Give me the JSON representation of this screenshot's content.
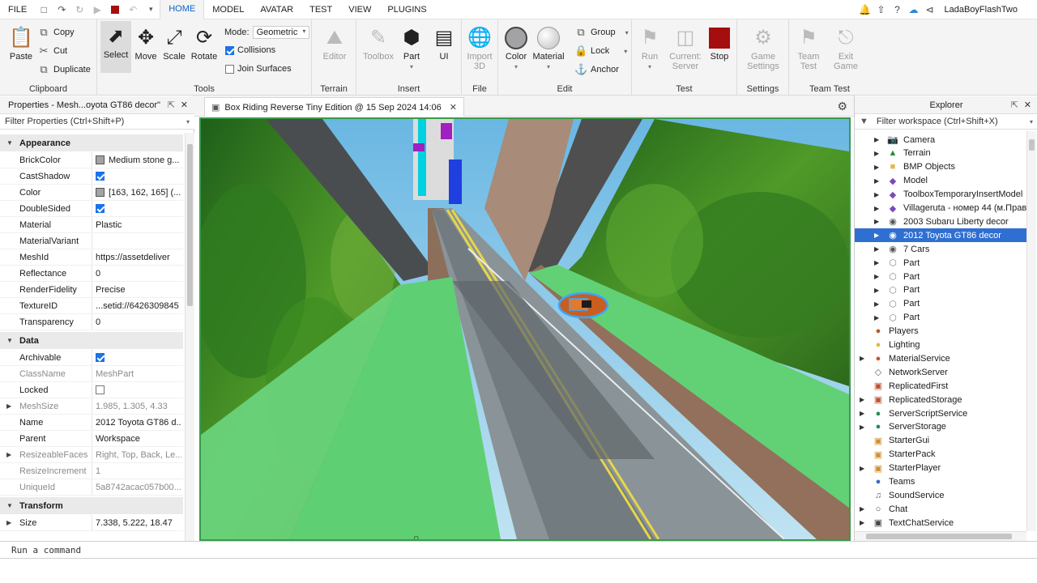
{
  "menubar": {
    "file_label": "FILE",
    "tabs": [
      "HOME",
      "MODEL",
      "AVATAR",
      "TEST",
      "VIEW",
      "PLUGINS"
    ],
    "active_tab": "HOME",
    "username": "LadaBoyFlashTwo"
  },
  "ribbon": {
    "clipboard": {
      "paste": "Paste",
      "copy": "Copy",
      "cut": "Cut",
      "duplicate": "Duplicate",
      "label": "Clipboard"
    },
    "tools": {
      "select": "Select",
      "move": "Move",
      "scale": "Scale",
      "rotate": "Rotate",
      "mode_label": "Mode:",
      "mode_value": "Geometric",
      "collisions": "Collisions",
      "join_surfaces": "Join Surfaces",
      "label": "Tools"
    },
    "terrain": {
      "editor": "Editor",
      "label": "Terrain"
    },
    "insert": {
      "toolbox": "Toolbox",
      "part": "Part",
      "ui": "UI",
      "label": "Insert"
    },
    "file": {
      "import_line1": "Import",
      "import_line2": "3D",
      "label": "File"
    },
    "edit": {
      "color": "Color",
      "material": "Material",
      "group": "Group",
      "lock": "Lock",
      "anchor": "Anchor",
      "label": "Edit"
    },
    "test": {
      "run": "Run",
      "current_line1": "Current:",
      "current_line2": "Server",
      "stop": "Stop",
      "label": "Test"
    },
    "settings": {
      "game_line1": "Game",
      "game_line2": "Settings",
      "label": "Settings"
    },
    "team_test": {
      "team_line1": "Team",
      "team_line2": "Test",
      "exit_line1": "Exit",
      "exit_line2": "Game",
      "label": "Team Test"
    }
  },
  "properties": {
    "title": "Properties - Mesh...oyota GT86 decor\"",
    "filter_placeholder": "Filter Properties (Ctrl+Shift+P)",
    "sections": [
      {
        "name": "Appearance",
        "rows": [
          {
            "name": "BrickColor",
            "value": "Medium stone g...",
            "swatch": "#a3a2a5"
          },
          {
            "name": "CastShadow",
            "check": true
          },
          {
            "name": "Color",
            "value": "[163, 162, 165] (...",
            "swatch": "#a3a2a5"
          },
          {
            "name": "DoubleSided",
            "check": true
          },
          {
            "name": "Material",
            "value": "Plastic"
          },
          {
            "name": "MaterialVariant",
            "value": ""
          },
          {
            "name": "MeshId",
            "value": "https://assetdeliver"
          },
          {
            "name": "Reflectance",
            "value": "0"
          },
          {
            "name": "RenderFidelity",
            "value": "Precise"
          },
          {
            "name": "TextureID",
            "value": "...setid://6426309845"
          },
          {
            "name": "Transparency",
            "value": "0"
          }
        ]
      },
      {
        "name": "Data",
        "rows": [
          {
            "name": "Archivable",
            "check": true
          },
          {
            "name": "ClassName",
            "value": "MeshPart",
            "gray": true
          },
          {
            "name": "Locked",
            "check": false
          },
          {
            "name": "MeshSize",
            "value": "1.985, 1.305, 4.33",
            "gray": true,
            "expand": true
          },
          {
            "name": "Name",
            "value": "2012 Toyota GT86 d..."
          },
          {
            "name": "Parent",
            "value": "Workspace"
          },
          {
            "name": "ResizeableFaces",
            "value": "Right, Top, Back, Le...",
            "gray": true,
            "expand": true
          },
          {
            "name": "ResizeIncrement",
            "value": "1",
            "gray": true
          },
          {
            "name": "UniqueId",
            "value": "5a8742acac057b00...",
            "gray": true
          }
        ]
      },
      {
        "name": "Transform",
        "rows": [
          {
            "name": "Size",
            "value": "7.338, 5.222, 18.47",
            "expand": true
          }
        ]
      }
    ]
  },
  "document": {
    "tab_title": "Box Riding Reverse Tiny Edition @ 15 Sep 2024 14:06"
  },
  "explorer": {
    "title": "Explorer",
    "filter_placeholder": "Filter workspace (Ctrl+Shift+X)",
    "items": [
      {
        "label": "Camera",
        "icon": "camera-icon",
        "depth": 1,
        "tri": true
      },
      {
        "label": "Terrain",
        "icon": "terrain-icon",
        "depth": 1,
        "tri": true
      },
      {
        "label": "BMP Objects",
        "icon": "folder-icon",
        "depth": 1,
        "tri": true
      },
      {
        "label": "Model",
        "icon": "model-icon",
        "depth": 1,
        "tri": true
      },
      {
        "label": "ToolboxTemporaryInsertModel",
        "icon": "model-icon",
        "depth": 1,
        "tri": true
      },
      {
        "label": "Villageruta - номер 44 (м.Правд",
        "icon": "model-icon",
        "depth": 1,
        "tri": true
      },
      {
        "label": "2003 Subaru Liberty decor",
        "icon": "meshpart-icon",
        "depth": 1,
        "tri": true
      },
      {
        "label": "2012 Toyota GT86 decor",
        "icon": "meshpart-icon",
        "depth": 1,
        "tri": true,
        "selected": true
      },
      {
        "label": "7 Cars",
        "icon": "meshpart-icon",
        "depth": 1,
        "tri": true
      },
      {
        "label": "Part",
        "icon": "part-icon",
        "depth": 1,
        "tri": true
      },
      {
        "label": "Part",
        "icon": "part-icon",
        "depth": 1,
        "tri": true
      },
      {
        "label": "Part",
        "icon": "part-icon",
        "depth": 1,
        "tri": true
      },
      {
        "label": "Part",
        "icon": "part-icon",
        "depth": 1,
        "tri": true
      },
      {
        "label": "Part",
        "icon": "part-icon",
        "depth": 1,
        "tri": true
      },
      {
        "label": "Players",
        "icon": "players-icon",
        "depth": 0,
        "tri": false
      },
      {
        "label": "Lighting",
        "icon": "lighting-icon",
        "depth": 0,
        "tri": false
      },
      {
        "label": "MaterialService",
        "icon": "material-service-icon",
        "depth": 0,
        "tri": true
      },
      {
        "label": "NetworkServer",
        "icon": "network-icon",
        "depth": 0,
        "tri": false
      },
      {
        "label": "ReplicatedFirst",
        "icon": "replicated-first-icon",
        "depth": 0,
        "tri": false
      },
      {
        "label": "ReplicatedStorage",
        "icon": "replicated-storage-icon",
        "depth": 0,
        "tri": true
      },
      {
        "label": "ServerScriptService",
        "icon": "server-script-icon",
        "depth": 0,
        "tri": true
      },
      {
        "label": "ServerStorage",
        "icon": "server-storage-icon",
        "depth": 0,
        "tri": true
      },
      {
        "label": "StarterGui",
        "icon": "starter-gui-icon",
        "depth": 0,
        "tri": false
      },
      {
        "label": "StarterPack",
        "icon": "starter-pack-icon",
        "depth": 0,
        "tri": false
      },
      {
        "label": "StarterPlayer",
        "icon": "starter-player-icon",
        "depth": 0,
        "tri": true
      },
      {
        "label": "Teams",
        "icon": "teams-icon",
        "depth": 0,
        "tri": false
      },
      {
        "label": "SoundService",
        "icon": "sound-icon",
        "depth": 0,
        "tri": false
      },
      {
        "label": "Chat",
        "icon": "chat-icon",
        "depth": 0,
        "tri": true
      },
      {
        "label": "TextChatService",
        "icon": "text-chat-icon",
        "depth": 0,
        "tri": true
      }
    ]
  },
  "command_bar": {
    "placeholder": "Run a command"
  },
  "colors": {
    "accent": "#0a63c9",
    "selection": "#2f6fd1",
    "stop": "#a50e0e",
    "viewport_border": "#3a9a4a"
  }
}
